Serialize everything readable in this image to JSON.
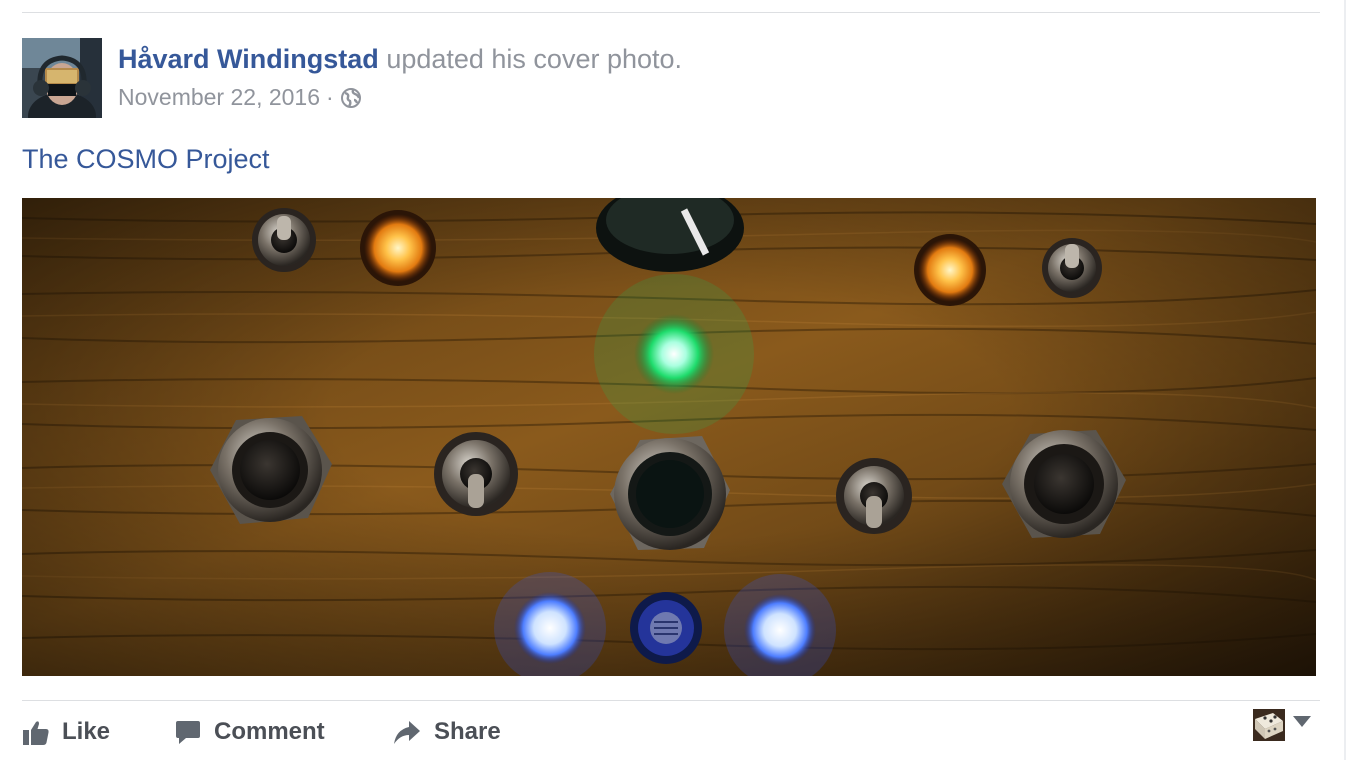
{
  "post": {
    "author": "Håvard Windingstad",
    "action": "updated his cover photo.",
    "date": "November 22, 2016",
    "separator": "·",
    "privacy_icon": "globe-icon",
    "album_title": "The COSMO Project"
  },
  "actions": {
    "like_label": "Like",
    "comment_label": "Comment",
    "share_label": "Share"
  },
  "colors": {
    "link": "#365899",
    "meta": "#90949c",
    "action_text": "#4b4f56",
    "divider": "#dddfe2"
  }
}
